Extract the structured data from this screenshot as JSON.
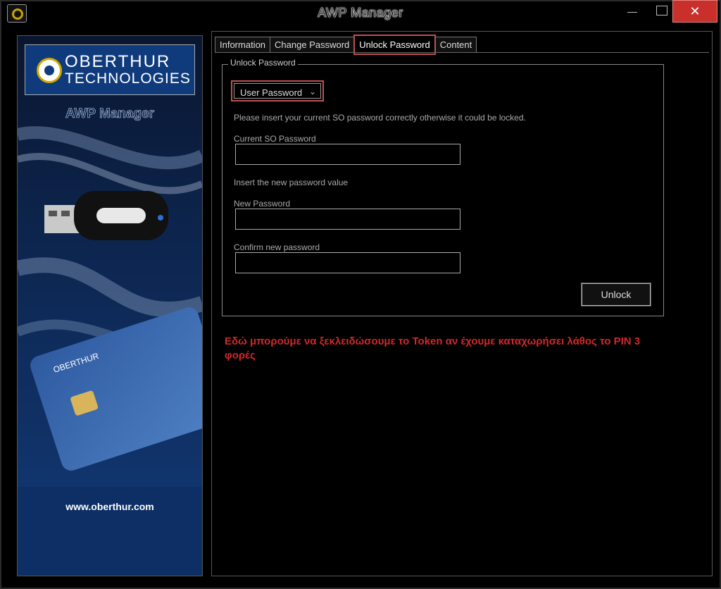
{
  "window": {
    "title": "AWP Manager",
    "minimize_glyph": "—",
    "close_glyph": "✕"
  },
  "branding": {
    "logo_line1": "OBERTHUR",
    "logo_line2": "TECHNOLOGIES",
    "product_title": "AWP Manager",
    "url": "www.oberthur.com",
    "accent_color": "#0f3b7d"
  },
  "tabs": [
    {
      "label": "Information"
    },
    {
      "label": "Change Password"
    },
    {
      "label": "Unlock Password",
      "active": true
    },
    {
      "label": "Content"
    }
  ],
  "unlock_panel": {
    "group_title": "Unlock Password",
    "password_type": "User Password",
    "instruction_current": "Please insert your current SO password correctly otherwise it could be locked.",
    "current_label": "Current SO Password",
    "instruction_new": "Insert the new password value",
    "new_label": "New Password",
    "confirm_label": "Confirm new password",
    "current_value": "",
    "new_value": "",
    "confirm_value": "",
    "unlock_label": "Unlock"
  },
  "annotation": {
    "text": "Εδώ μπορούμε να ξεκλειδώσουμε το Token αν έχουμε καταχωρήσει λάθος το PIN 3 φορές",
    "color": "#d12828"
  }
}
